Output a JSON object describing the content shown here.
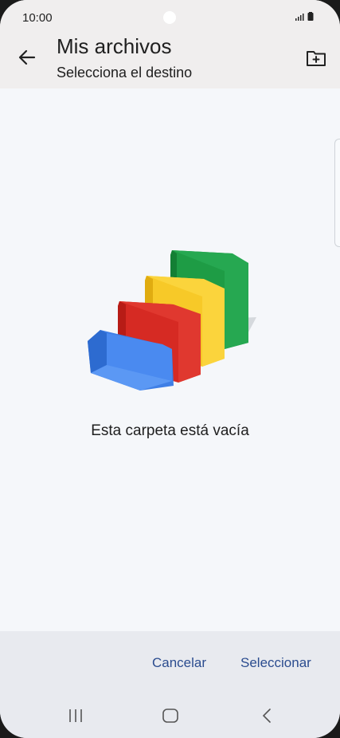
{
  "status_bar": {
    "time": "10:00"
  },
  "header": {
    "title": "Mis archivos",
    "subtitle": "Selecciona el destino",
    "back_icon": "arrow-left-icon",
    "new_folder_icon": "folder-plus-icon"
  },
  "content": {
    "empty_message": "Esta carpeta está vacía"
  },
  "actions": {
    "cancel_label": "Cancelar",
    "select_label": "Seleccionar"
  },
  "colors": {
    "accent": "#2b4c8f",
    "folder_blue": "#3f7fe6",
    "folder_red": "#d62a23",
    "folder_yellow": "#f7c928",
    "folder_green": "#1e9c45"
  }
}
